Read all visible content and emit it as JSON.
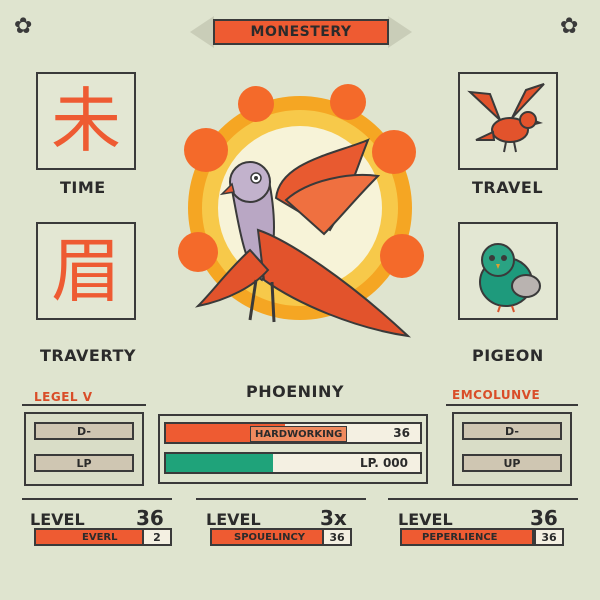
{
  "banner": {
    "title": "MONESTERY"
  },
  "left_cards": [
    {
      "glyph": "未",
      "label": "TIME"
    },
    {
      "glyph": "眉",
      "label": "TRAVERTY"
    }
  ],
  "right_cards": [
    {
      "label": "TRAVEL",
      "icon": "red-bird-icon"
    },
    {
      "label": "PIGEON",
      "icon": "pigeon-icon"
    }
  ],
  "center": {
    "creature_name": "PHOENINY"
  },
  "left_panel": {
    "heading": "LEGEL V",
    "slots": [
      "D-",
      "LP"
    ]
  },
  "right_panel": {
    "heading": "EMCOLUNVE",
    "slots": [
      "D-",
      "UP"
    ]
  },
  "bars": [
    {
      "tag": "HARDWORKING",
      "value": "36",
      "color": "#ee5b32",
      "fill": 0.47
    },
    {
      "tag": "LP. 000",
      "value": "",
      "color": "#1fa37a",
      "fill": 0.42
    }
  ],
  "levels": [
    {
      "title": "LEVEL",
      "number": "36",
      "bar_label": "EVERL",
      "value": "2"
    },
    {
      "title": "LEVEL",
      "number": "3x",
      "bar_label": "SPOUELINCY",
      "value": "36"
    },
    {
      "title": "LEVEL",
      "number": "36",
      "bar_label": "PEPERLIENCE",
      "value": "36"
    }
  ],
  "colors": {
    "accent": "#ee5b32",
    "green": "#1fa37a",
    "background": "#dfe4cf"
  }
}
